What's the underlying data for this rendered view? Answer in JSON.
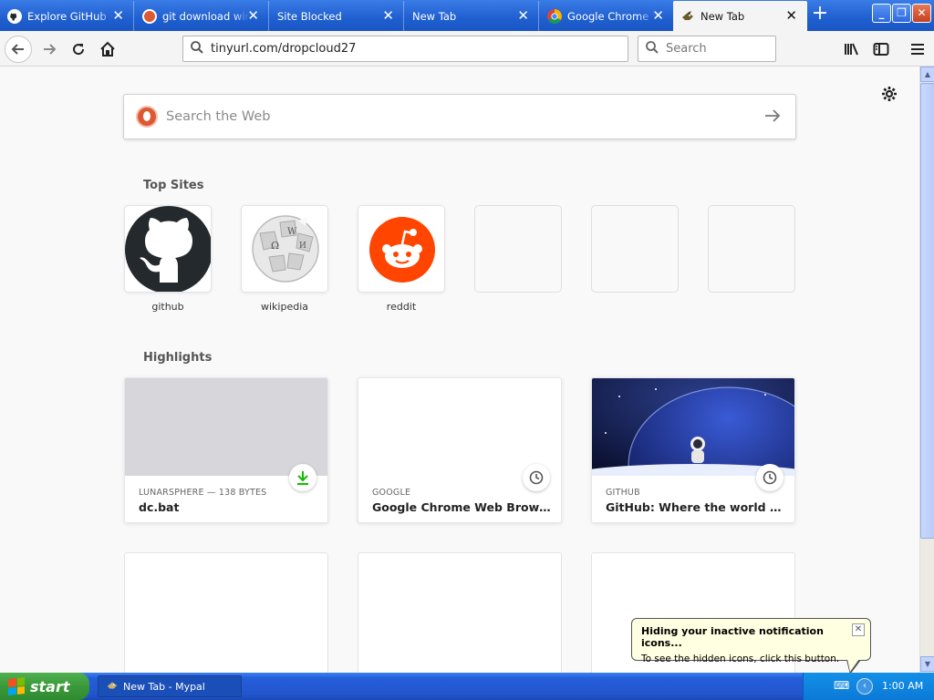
{
  "colors": {
    "tab_bar": "#1f5fd0",
    "taskbar": "#245edb",
    "start": "#3a9a3a",
    "tray": "#0b7ad6",
    "download_green": "#12bc00"
  },
  "tabs": [
    {
      "title": "Explore GitHub · GitHub",
      "icon": "github-icon",
      "active": false
    },
    {
      "title": "git download windows",
      "icon": "duckduckgo-icon",
      "active": false
    },
    {
      "title": "Site Blocked",
      "icon": "",
      "active": false
    },
    {
      "title": "New Tab",
      "icon": "",
      "active": false
    },
    {
      "title": "Google Chrome Web Browser",
      "icon": "chrome-icon",
      "active": false
    },
    {
      "title": "New Tab",
      "icon": "mypal-icon",
      "active": true
    }
  ],
  "toolbar": {
    "url": "tinyurl.com/dropcloud27",
    "search_placeholder": "Search"
  },
  "websearch": {
    "placeholder": "Search the Web"
  },
  "top_sites": {
    "title": "Top Sites",
    "items": [
      {
        "label": "github",
        "icon": "github-logo"
      },
      {
        "label": "wikipedia",
        "icon": "wikipedia-globe"
      },
      {
        "label": "reddit",
        "icon": "reddit-logo"
      },
      {
        "label": "",
        "icon": ""
      },
      {
        "label": "",
        "icon": ""
      },
      {
        "label": "",
        "icon": ""
      }
    ]
  },
  "highlights": {
    "title": "Highlights",
    "cards": [
      {
        "source": "LUNARSPHERE — 138 BYTES",
        "title": "dc.bat",
        "badge": "download-icon"
      },
      {
        "source": "GOOGLE",
        "title": "Google Chrome Web Browser",
        "badge": "clock-icon"
      },
      {
        "source": "GITHUB",
        "title": "GitHub: Where the world builds ...",
        "badge": "clock-icon"
      }
    ]
  },
  "taskbar": {
    "start_label": "start",
    "task_label": "New Tab - Mypal",
    "clock": "1:00 AM"
  },
  "balloon": {
    "title": "Hiding your inactive notification icons...",
    "body": "To see the hidden icons, click this button."
  }
}
